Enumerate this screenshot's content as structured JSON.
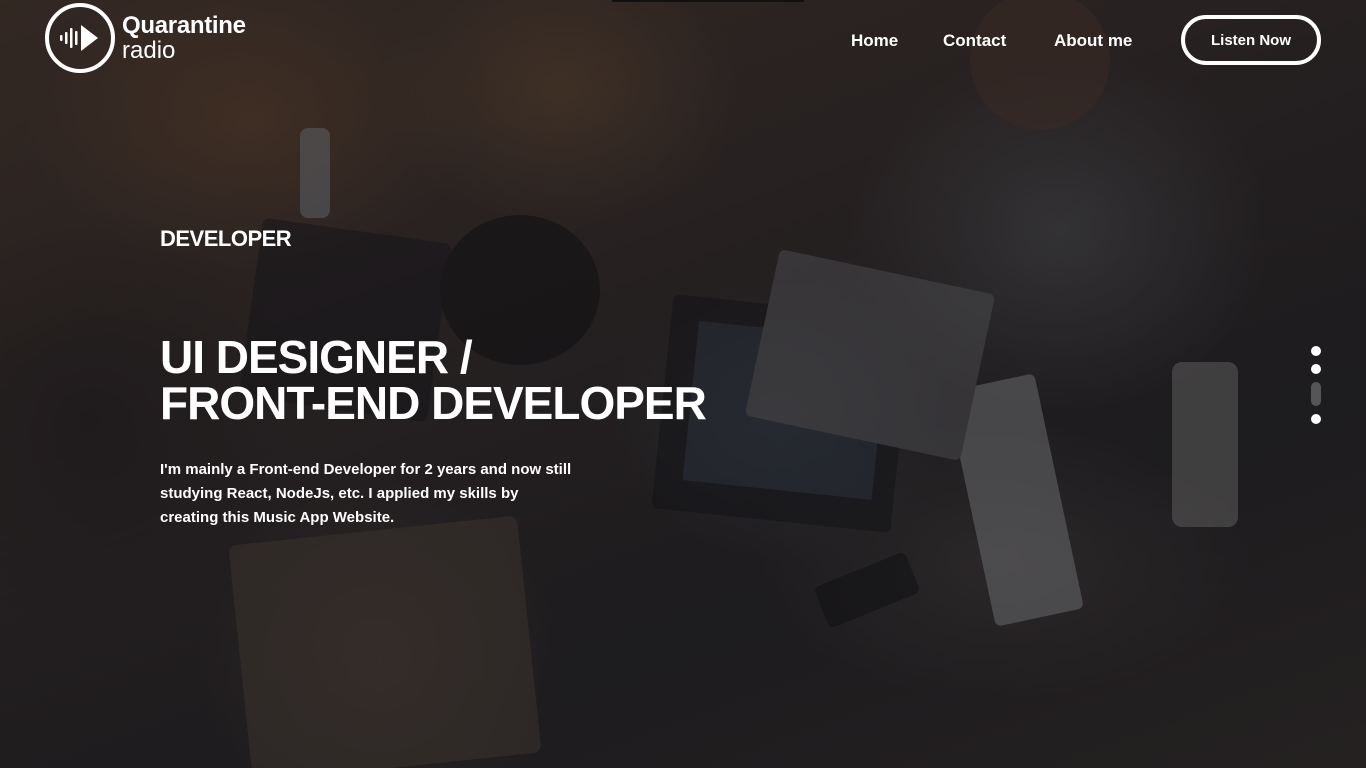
{
  "brand": {
    "name_line1": "Quarantine",
    "name_line2": "radio",
    "logo_icon": "sound-wave-play-icon"
  },
  "nav": {
    "items": [
      {
        "label": "Home"
      },
      {
        "label": "Contact"
      },
      {
        "label": "About me"
      }
    ],
    "cta_label": "Listen Now"
  },
  "hero": {
    "eyebrow": "DEVELOPER",
    "headline_line1": "UI DESIGNER /",
    "headline_line2": "FRONT-END DEVELOPER",
    "description": "I'm mainly a Front-end Developer for 2 years and now still studying React, NodeJs, etc. I applied my skills by creating this Music App Website.",
    "background": "photo-people-working-on-laptops"
  },
  "slider": {
    "total": 4,
    "active_index": 2
  },
  "colors": {
    "text": "#ffffff",
    "overlay": "#121014"
  }
}
